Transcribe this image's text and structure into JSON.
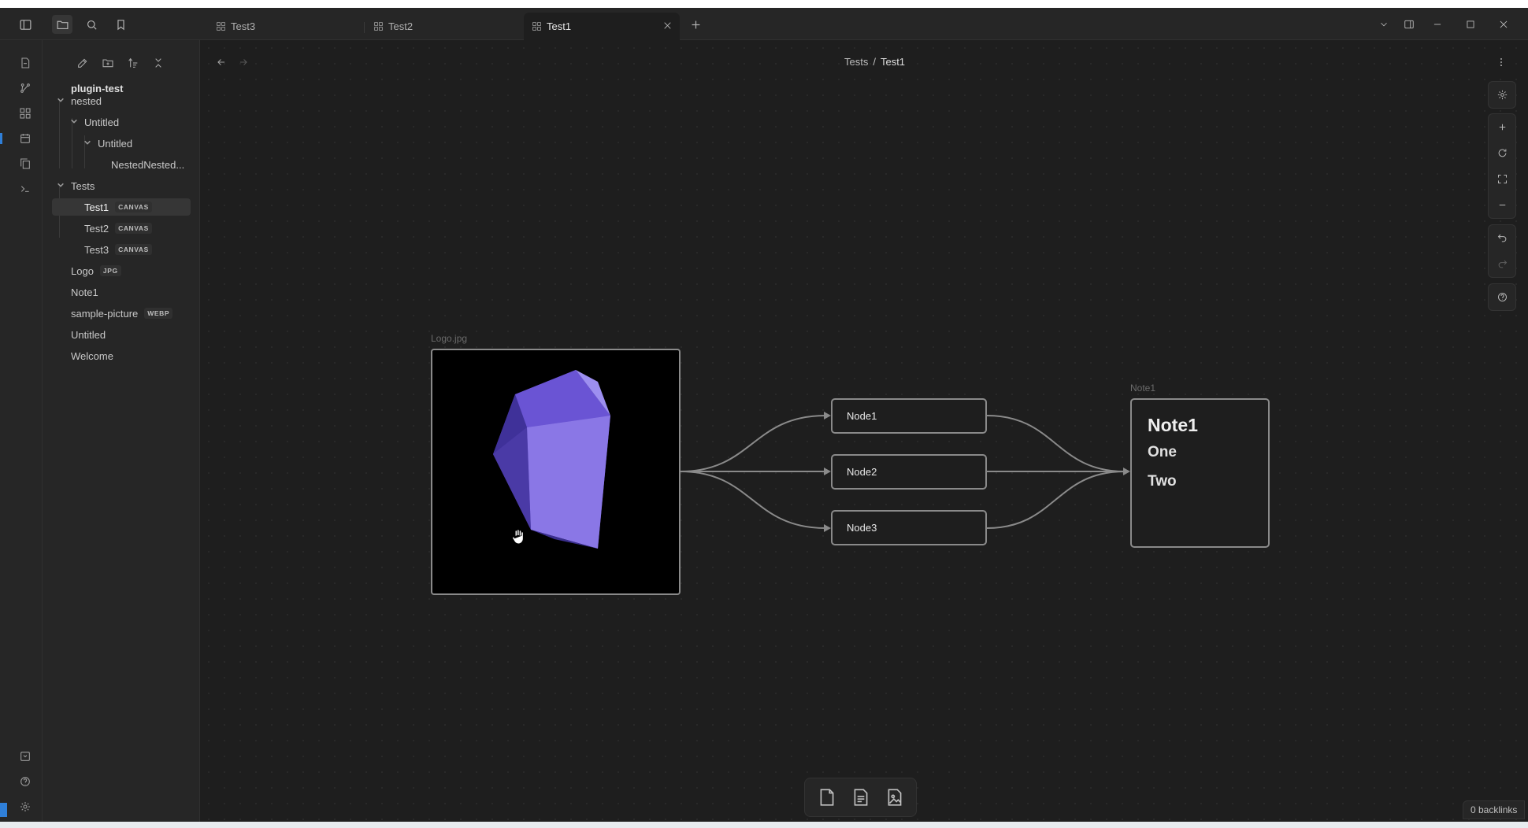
{
  "tabs": [
    {
      "label": "Test3",
      "active": false
    },
    {
      "label": "Test2",
      "active": false
    },
    {
      "label": "Test1",
      "active": true
    }
  ],
  "sidebar": {
    "vault_name": "plugin-test",
    "tree": [
      {
        "label": "nested",
        "type": "folder"
      },
      {
        "label": "Untitled",
        "type": "folder"
      },
      {
        "label": "Untitled",
        "type": "folder"
      },
      {
        "label": "NestedNested...",
        "type": "file"
      },
      {
        "label": "Tests",
        "type": "folder"
      },
      {
        "label": "Test1",
        "badge": "CANVAS",
        "selected": true
      },
      {
        "label": "Test2",
        "badge": "CANVAS"
      },
      {
        "label": "Test3",
        "badge": "CANVAS"
      },
      {
        "label": "Logo",
        "badge": "JPG"
      },
      {
        "label": "Note1"
      },
      {
        "label": "sample-picture",
        "badge": "WEBP"
      },
      {
        "label": "Untitled"
      },
      {
        "label": "Welcome"
      }
    ]
  },
  "breadcrumb": {
    "parent": "Tests",
    "separator": "/",
    "current": "Test1"
  },
  "canvas": {
    "image_node": {
      "label": "Logo.jpg"
    },
    "text_nodes": [
      "Node1",
      "Node2",
      "Node3"
    ],
    "note_node": {
      "label": "Note1",
      "title": "Note1",
      "lines": [
        "One",
        "Two"
      ]
    }
  },
  "status": {
    "backlinks": "0 backlinks"
  },
  "colors": {
    "accent": "#7c63d6",
    "background": "#1e1e1e",
    "panel": "#262626",
    "edge": "#8a8a8a"
  }
}
